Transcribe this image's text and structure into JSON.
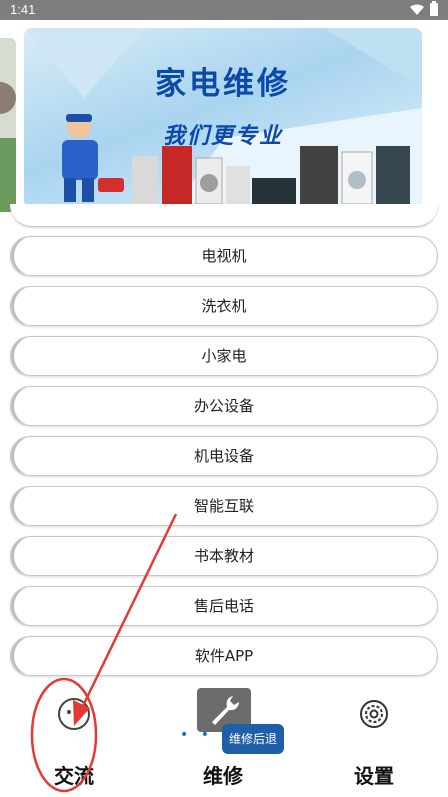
{
  "status_bar": {
    "time": "1:41"
  },
  "banner": {
    "title": "家电维修",
    "subtitle": "我们更专业"
  },
  "categories": [
    "电视机",
    "洗衣机",
    "小家电",
    "办公设备",
    "机电设备",
    "智能互联",
    "书本教材",
    "售后电话",
    "软件APP"
  ],
  "tabs": [
    {
      "label": "交流",
      "icon": "chat-icon"
    },
    {
      "label": "维修",
      "icon": "wrench-icon"
    },
    {
      "label": "设置",
      "icon": "gear-icon"
    }
  ],
  "tooltip": "维修后退",
  "colors": {
    "accent": "#1f5fa8",
    "annotation": "#e53935",
    "status_bar": "#7d7d7d"
  }
}
